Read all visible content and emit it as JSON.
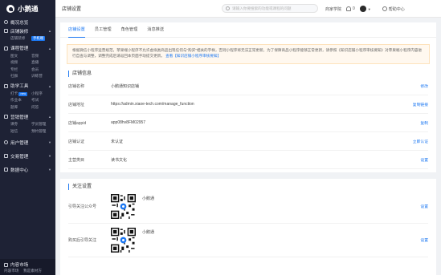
{
  "app": {
    "name": "小鹅通"
  },
  "sidebar": {
    "sections": [
      {
        "label": "概况总览",
        "items": []
      },
      {
        "label": "店铺装修",
        "items": [
          {
            "label": "店铺装修",
            "active": false
          },
          {
            "label": "手机端",
            "chip": true
          }
        ]
      },
      {
        "label": "课程管理",
        "items": [
          {
            "label": "图文"
          },
          {
            "label": "音频"
          },
          {
            "label": "视频"
          },
          {
            "label": "直播"
          },
          {
            "label": "专栏"
          },
          {
            "label": "会员"
          },
          {
            "label": "社群"
          },
          {
            "label": "训练营"
          }
        ]
      },
      {
        "label": "助学工具",
        "items": [
          {
            "label": "打卡",
            "badge": "new"
          },
          {
            "label": "小程序"
          },
          {
            "label": "作业本"
          },
          {
            "label": "考试"
          },
          {
            "label": "题库"
          },
          {
            "label": "问答"
          }
        ]
      },
      {
        "label": "营销管理",
        "items": [
          {
            "label": "课券"
          },
          {
            "label": "学员管理"
          },
          {
            "label": "短信"
          },
          {
            "label": "预约管理"
          }
        ]
      },
      {
        "label": "用户管理",
        "items": []
      },
      {
        "label": "交易管理",
        "items": []
      },
      {
        "label": "数据中心",
        "items": []
      }
    ],
    "footer": {
      "label": "内容市场",
      "items": [
        {
          "label": "内容市场"
        },
        {
          "label": "我是素材方"
        }
      ]
    }
  },
  "topbar": {
    "page_title": "店铺设置",
    "search_placeholder": "请输入你要搜索的功能或课程的问题",
    "links": {
      "academy": "商家学院",
      "help": "帮助中心"
    },
    "notif_count": "0"
  },
  "tabs": [
    {
      "label": "店铺设置",
      "active": true
    },
    {
      "label": "员工管理",
      "active": false
    },
    {
      "label": "角色管理",
      "active": false
    },
    {
      "label": "消息推送",
      "active": false
    }
  ],
  "notice": {
    "text": "根据微信小程序运营规范，苹果端小程序不允许虚拟类商品出现任何与\"购买\"相关的字样，否则小程序将无法正常更新。为了保障商品小程序能够正常更新，请参照《知识店铺小程序审核要知》对苹果端小程序内容进行自查与调整，调整完成后请返回本页面手动提交更新。",
    "link": "查看【知识店铺小程序审核要知】"
  },
  "shop_info": {
    "title": "店铺信息",
    "rows": [
      {
        "label": "店铺名称",
        "value": "小鹅通知识店铺",
        "action": "修改"
      },
      {
        "label": "店铺地址",
        "value": "https://admin.xiaoe-tech.com/manage_function",
        "action": "复制链接"
      },
      {
        "label": "店铺appid",
        "value": "app08hv8FM02957",
        "action": "复制"
      },
      {
        "label": "店铺认证",
        "value": "未认证",
        "action": "立即认证"
      },
      {
        "label": "主营类目",
        "value": "读书文化",
        "action": "设置"
      }
    ]
  },
  "follow": {
    "title": "关注设置",
    "rows": [
      {
        "label": "引导关注公众号",
        "name": "小鹅通",
        "action": "设置"
      },
      {
        "label": "购买后引导关注",
        "name": "小鹅通",
        "action": "设置"
      }
    ]
  },
  "colors": {
    "accent": "#1b77f2",
    "sidebar": "#1e2235",
    "notice_bg": "#fff8ef"
  }
}
